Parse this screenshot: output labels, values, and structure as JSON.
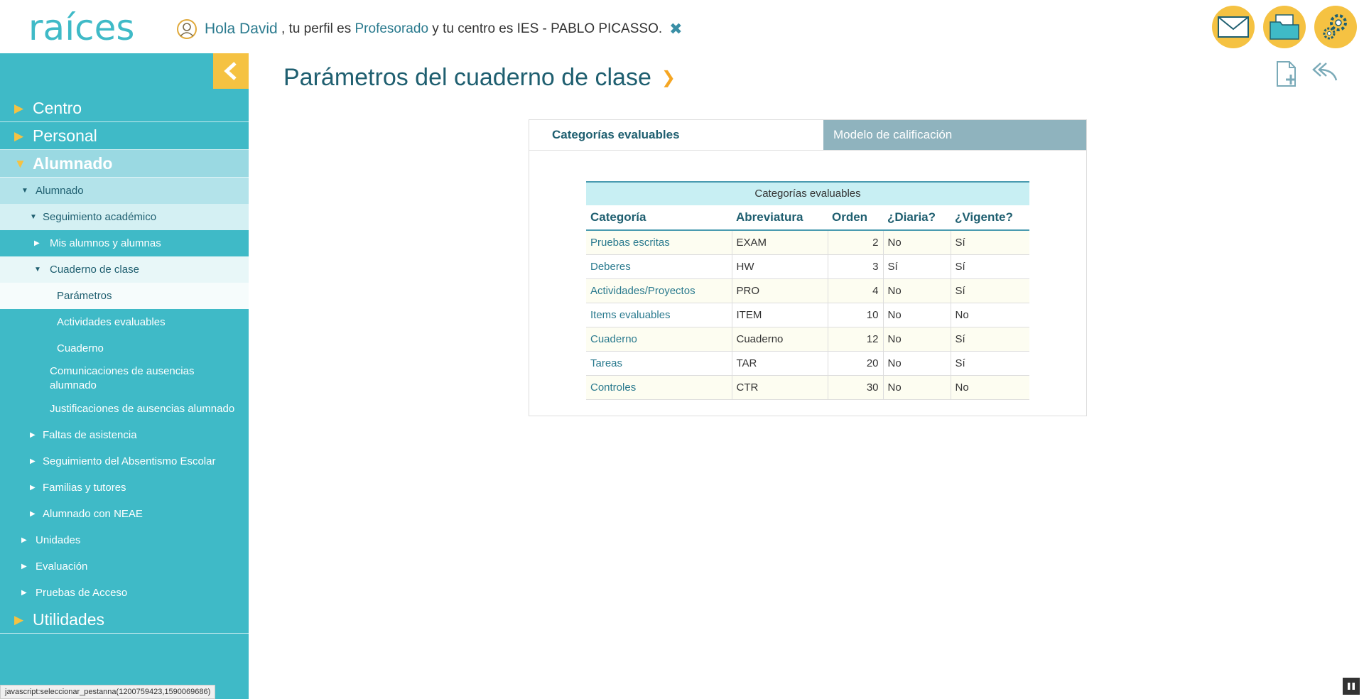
{
  "header": {
    "logo_text": "raíces",
    "greeting": {
      "hello": "Hola David",
      "profile_prefix": ", tu perfil es",
      "profile": "Profesorado",
      "centre_prefix": "y tu centro es",
      "centre": "IES - PABLO PICASSO."
    },
    "icons": [
      "mail-icon",
      "folder-icon",
      "settings-gear-icon"
    ]
  },
  "sidebar": {
    "collapse_icon": "chevron-left-icon",
    "items": [
      {
        "label": "Centro",
        "level": 1
      },
      {
        "label": "Personal",
        "level": 1
      },
      {
        "label": "Alumnado",
        "level": 1,
        "active": true
      },
      {
        "label": "Alumnado",
        "level": 2,
        "active": true
      },
      {
        "label": "Seguimiento académico",
        "level": 3,
        "active": true
      },
      {
        "label": "Mis alumnos y alumnas",
        "level": 4
      },
      {
        "label": "Cuaderno de clase",
        "level": 4,
        "active": true
      },
      {
        "label": "Parámetros",
        "level": 5,
        "active": true
      },
      {
        "label": "Actividades evaluables",
        "level": 5
      },
      {
        "label": "Cuaderno",
        "level": 5
      },
      {
        "label": "Comunicaciones de ausencias alumnado",
        "level": 4
      },
      {
        "label": "Justificaciones de ausencias alumnado",
        "level": 4
      },
      {
        "label": "Faltas de asistencia",
        "level": 3
      },
      {
        "label": "Seguimiento del Absentismo Escolar",
        "level": 3
      },
      {
        "label": "Familias y tutores",
        "level": 3
      },
      {
        "label": "Alumnado con NEAE",
        "level": 3
      },
      {
        "label": "Unidades",
        "level": 2
      },
      {
        "label": "Evaluación",
        "level": 2
      },
      {
        "label": "Pruebas de Acceso",
        "level": 2
      },
      {
        "label": "Utilidades",
        "level": 1
      }
    ]
  },
  "main": {
    "title": "Parámetros del cuaderno de clase",
    "actions": [
      "add-document-icon",
      "reply-back-icon"
    ],
    "tabs": [
      {
        "label": "Categorías evaluables",
        "selected": true
      },
      {
        "label": "Modelo de calificación",
        "selected": false
      }
    ],
    "table": {
      "caption": "Categorías evaluables",
      "columns": [
        "Categoría",
        "Abreviatura",
        "Orden",
        "¿Diaria?",
        "¿Vigente?"
      ],
      "rows": [
        [
          "Pruebas escritas",
          "EXAM",
          "2",
          "No",
          "Sí"
        ],
        [
          "Deberes",
          "HW",
          "3",
          "Sí",
          "Sí"
        ],
        [
          "Actividades/Proyectos",
          "PRO",
          "4",
          "No",
          "Sí"
        ],
        [
          "Items evaluables",
          "ITEM",
          "10",
          "No",
          "No"
        ],
        [
          "Cuaderno",
          "Cuaderno",
          "12",
          "No",
          "Sí"
        ],
        [
          "Tareas",
          "TAR",
          "20",
          "No",
          "Sí"
        ],
        [
          "Controles",
          "CTR",
          "30",
          "No",
          "No"
        ]
      ]
    }
  },
  "status_bar": "javascript:seleccionar_pestanna(1200759423,1590069686)",
  "colors": {
    "accent": "#3fbac7",
    "highlight": "#f5c242",
    "text_dark": "#1f5f70"
  }
}
